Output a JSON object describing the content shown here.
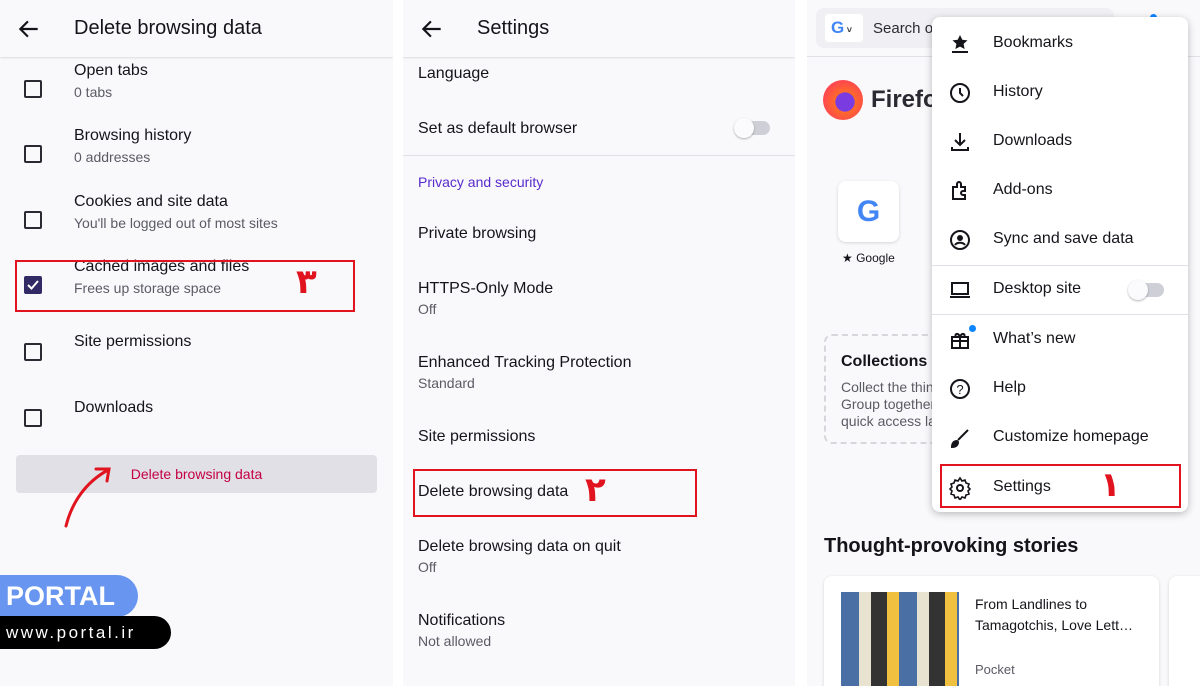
{
  "panel1": {
    "title": "Delete browsing data",
    "items": [
      {
        "label": "Open tabs",
        "sub": "0 tabs",
        "checked": false
      },
      {
        "label": "Browsing history",
        "sub": "0 addresses",
        "checked": false
      },
      {
        "label": "Cookies and site data",
        "sub": "You'll be logged out of most sites",
        "checked": false
      },
      {
        "label": "Cached images and files",
        "sub": "Frees up storage space",
        "checked": true
      },
      {
        "label": "Site permissions",
        "sub": "",
        "checked": false
      },
      {
        "label": "Downloads",
        "sub": "",
        "checked": false
      }
    ],
    "button": "Delete browsing data",
    "annotation": "۳"
  },
  "panel2": {
    "title": "Settings",
    "language": "Language",
    "default_browser": "Set as default browser",
    "section": "Privacy and security",
    "items": [
      {
        "label": "Private browsing",
        "sub": ""
      },
      {
        "label": "HTTPS-Only Mode",
        "sub": "Off"
      },
      {
        "label": "Enhanced Tracking Protection",
        "sub": "Standard"
      },
      {
        "label": "Site permissions",
        "sub": ""
      },
      {
        "label": "Delete browsing data",
        "sub": ""
      },
      {
        "label": "Delete browsing data on quit",
        "sub": "Off"
      },
      {
        "label": "Notifications",
        "sub": "Not allowed"
      }
    ],
    "annotation": "۲"
  },
  "panel3": {
    "search_placeholder": "Search o",
    "brand": "Firefo",
    "shortcut": "Google",
    "collections_title": "Collections",
    "collections_text": [
      "Collect the thin",
      "Group together",
      "quick access la"
    ],
    "stories_title": "Thought-provoking stories",
    "story_title": "From Landlines to Tamagotchis, Love Lett…",
    "story_source": "Pocket",
    "menu": [
      {
        "label": "Bookmarks",
        "icon": "bookmark-star-icon"
      },
      {
        "label": "History",
        "icon": "clock-icon"
      },
      {
        "label": "Downloads",
        "icon": "download-icon"
      },
      {
        "label": "Add-ons",
        "icon": "puzzle-icon"
      },
      {
        "label": "Sync and save data",
        "icon": "account-icon"
      },
      {
        "label": "Desktop site",
        "icon": "laptop-icon"
      },
      {
        "label": "What’s new",
        "icon": "gift-icon"
      },
      {
        "label": "Help",
        "icon": "help-icon"
      },
      {
        "label": "Customize homepage",
        "icon": "brush-icon"
      },
      {
        "label": "Settings",
        "icon": "gear-icon"
      }
    ],
    "annotation": "۱"
  },
  "watermark": {
    "brand": "PORTAL",
    "url": "www.portal.ir"
  },
  "colors": {
    "accent": "#312a65",
    "danger": "#c50042",
    "annotation": "#e0131e",
    "privacy": "#592acb"
  }
}
